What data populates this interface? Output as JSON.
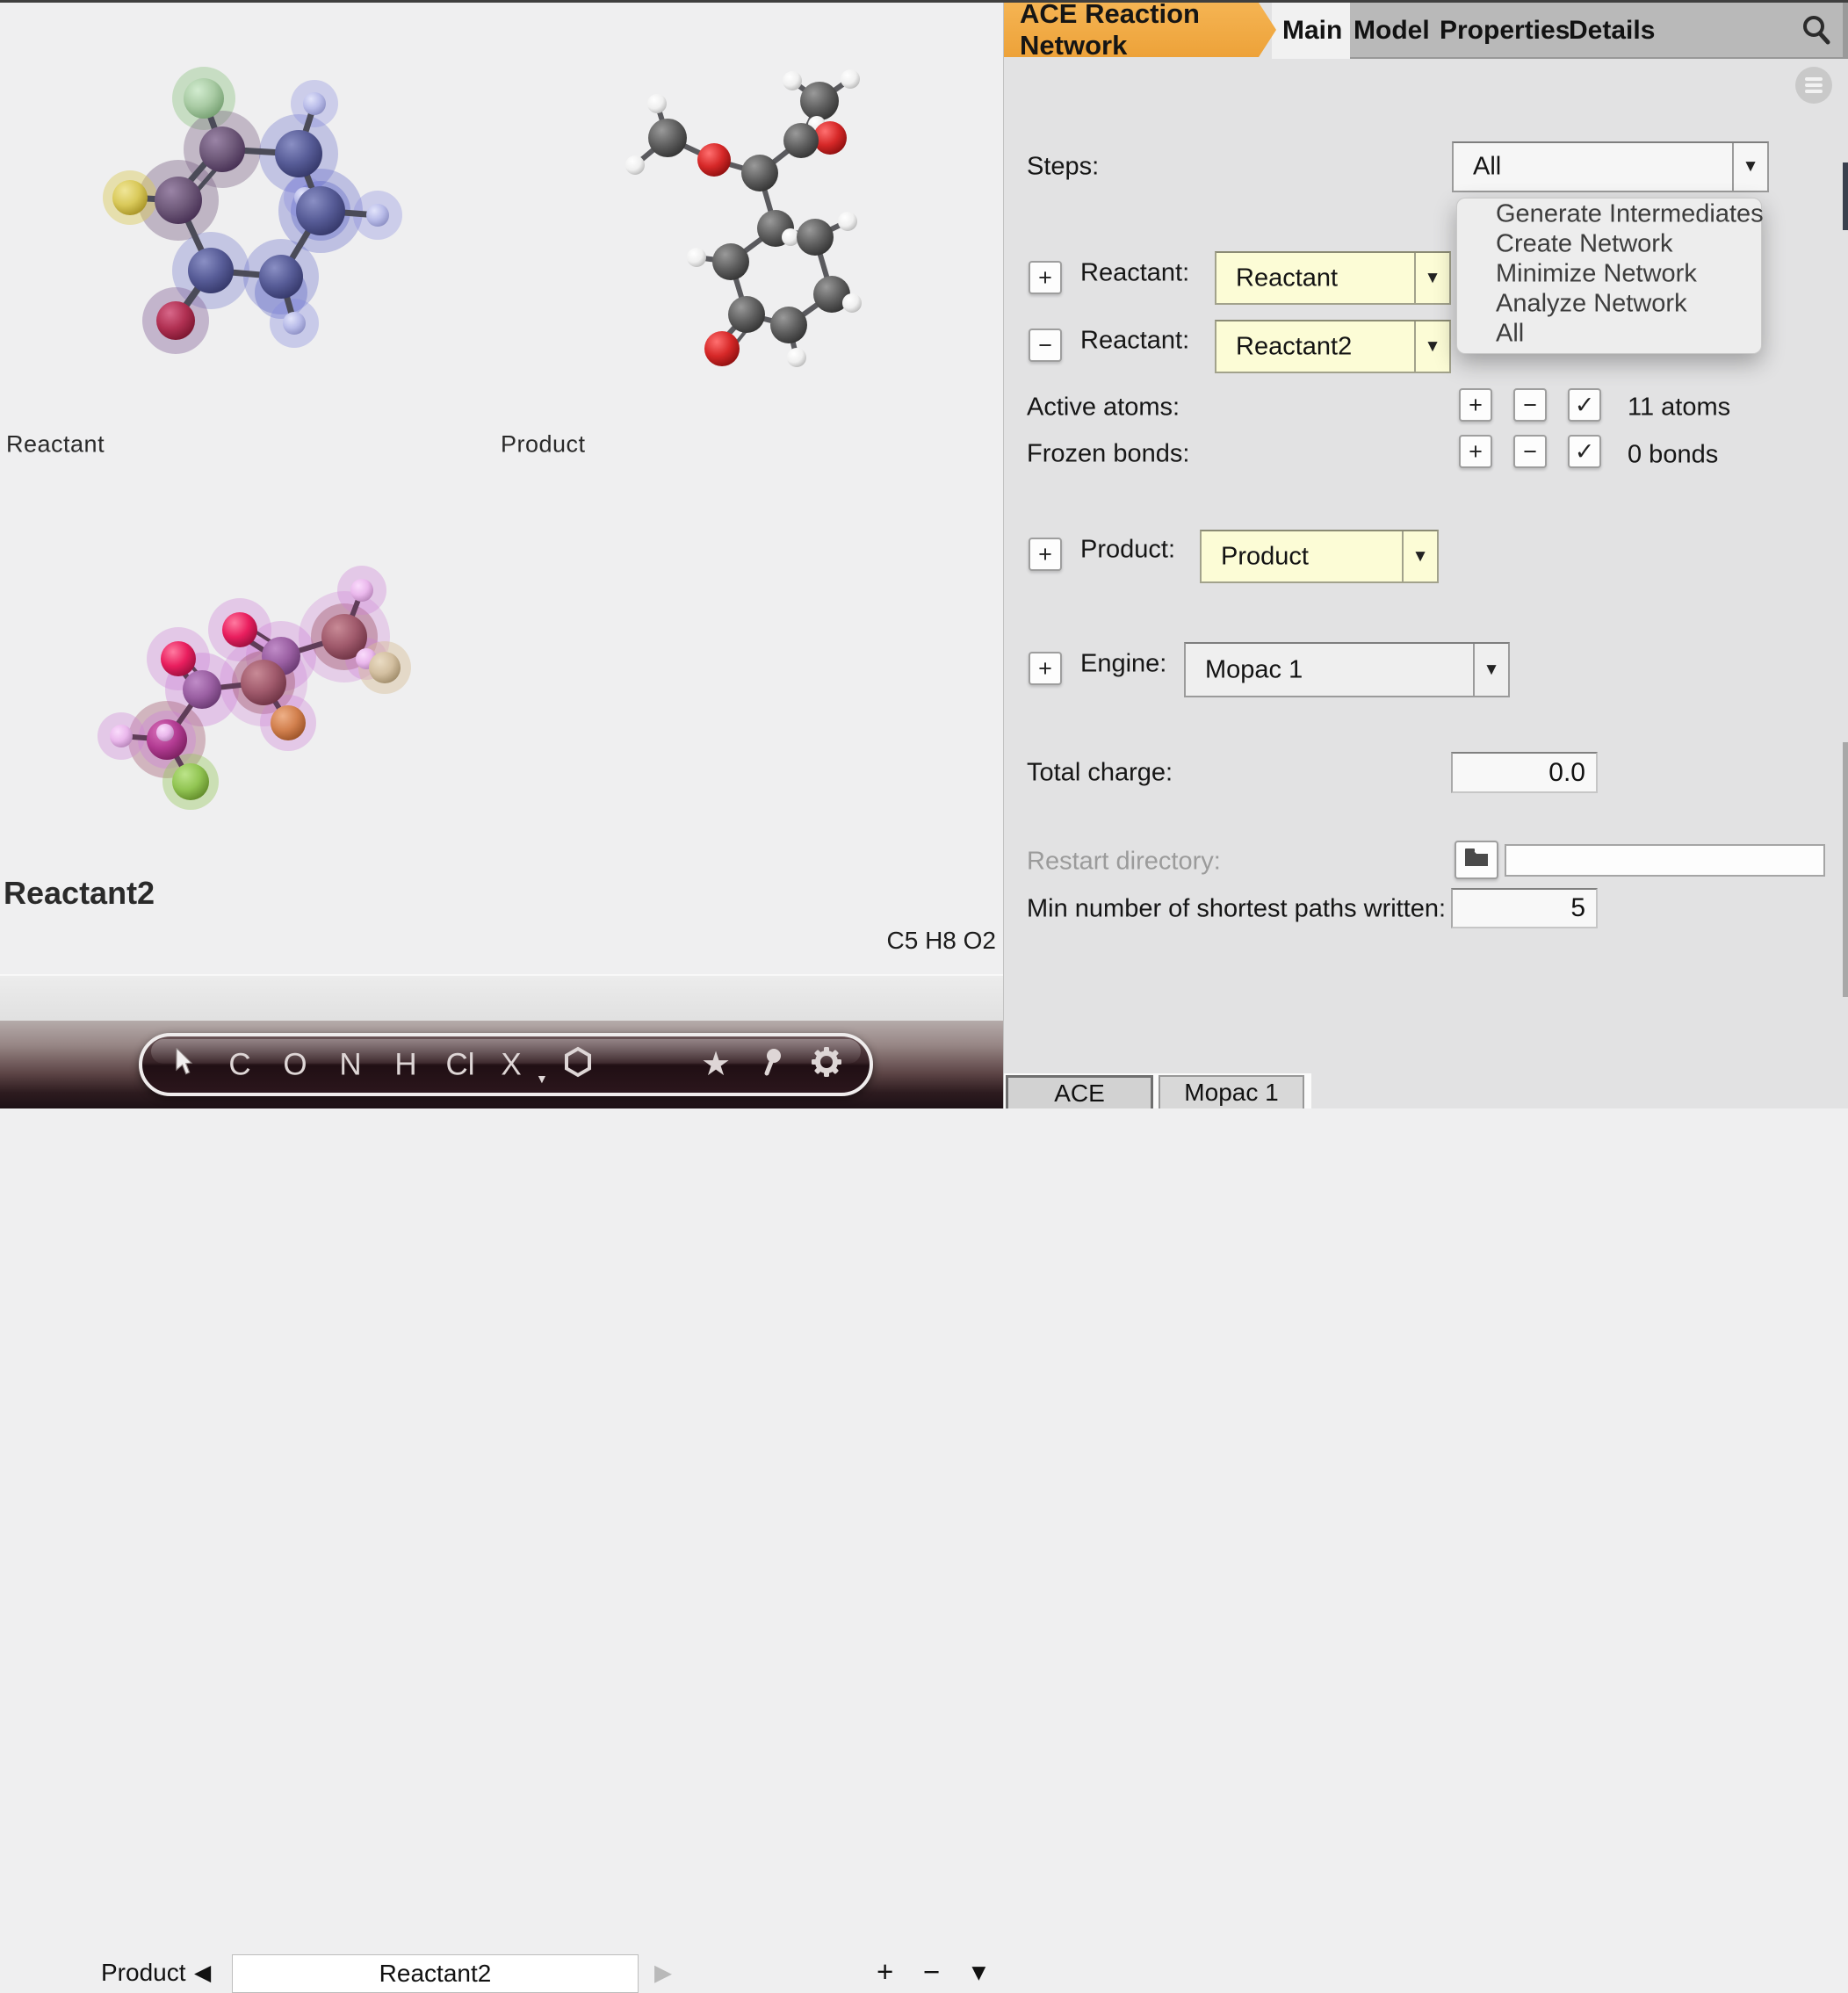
{
  "colors": {
    "accent_orange": "#f0a73f",
    "combo_yellow": "#fcfcd6",
    "panel_bg": "#e2e2e3",
    "viewer_bg": "#efeff0",
    "toolbar_dark": "#2b161c"
  },
  "symbols": {
    "plus": "+",
    "minus": "−",
    "check": "✓",
    "down_arrow": "▼",
    "prev_arrow": "◀",
    "next_arrow": "▶",
    "x_caret": "▼"
  },
  "viewer": {
    "reactant_label": "Reactant",
    "product_label": "Product",
    "reactant2_label": "Reactant2",
    "formula": "C5 H8 O2",
    "nav": {
      "prev_model": "Product",
      "current_model": "Reactant2"
    },
    "toolbar": {
      "elements": [
        "C",
        "O",
        "N",
        "H",
        "Cl",
        "X"
      ],
      "star": "★"
    }
  },
  "panel": {
    "title": "ACE Reaction Network",
    "tabs": {
      "main": "Main",
      "model": "Model",
      "properties": "Properties",
      "details": "Details"
    },
    "steps": {
      "label": "Steps:",
      "value": "All"
    },
    "steps_menu": [
      "Generate Intermediates",
      "Create Network",
      "Minimize Network",
      "Analyze Network",
      "All"
    ],
    "reactant1": {
      "label": "Reactant:",
      "value": "Reactant"
    },
    "reactant2": {
      "label": "Reactant:",
      "value": "Reactant2"
    },
    "active_atoms": {
      "label": "Active atoms:",
      "count": "11 atoms"
    },
    "frozen_bonds": {
      "label": "Frozen bonds:",
      "count": "0 bonds"
    },
    "product": {
      "label": "Product:",
      "value": "Product"
    },
    "engine": {
      "label": "Engine:",
      "value": "Mopac 1"
    },
    "total_charge": {
      "label": "Total charge:",
      "value": "0.0"
    },
    "restart_directory": {
      "label": "Restart directory:",
      "value": ""
    },
    "min_paths": {
      "label": "Min number of shortest paths written:",
      "value": "5"
    },
    "bottom_tabs": {
      "ace": "ACE",
      "mopac": "Mopac 1"
    }
  }
}
